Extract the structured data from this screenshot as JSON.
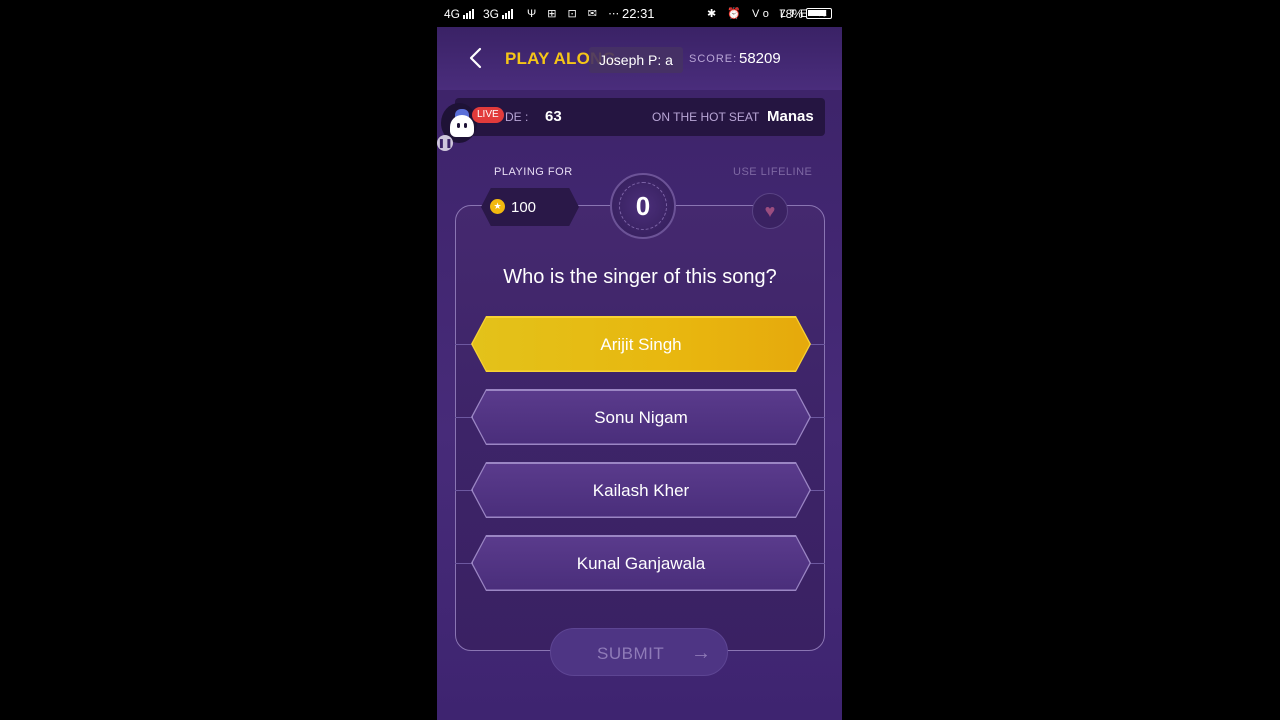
{
  "status_bar": {
    "signal1": "4G",
    "signal2": "3G",
    "time": "22:31",
    "left_icons": "Ψ ⊞ ⊡ ✉ ⋯",
    "right_icons": "✱ ⏰ Vo LTE ≋",
    "battery": "78%"
  },
  "header": {
    "title": "PLAY ALONG",
    "score_label": "SCORE:",
    "score_value": "58209",
    "toast": "Joseph P: a"
  },
  "info_bar": {
    "episode_label": "DE :",
    "episode_value": "63",
    "hotseat_label": "ON THE HOT SEAT",
    "hotseat_value": "Manas",
    "live_badge": "LIVE"
  },
  "game": {
    "playing_for_label": "PLAYING FOR",
    "coins_value": "100",
    "timer_value": "0",
    "use_lifeline_label": "USE LIFELINE",
    "question": "Who is the singer of this song?",
    "options": [
      {
        "label": "Arijit Singh",
        "selected": true
      },
      {
        "label": "Sonu Nigam",
        "selected": false
      },
      {
        "label": "Kailash Kher",
        "selected": false
      },
      {
        "label": "Kunal Ganjawala",
        "selected": false
      }
    ],
    "submit_label": "SUBMIT"
  },
  "colors": {
    "accent_gold": "#f5c518",
    "background_purple": "#412670",
    "selected_option": "#e8b70f",
    "live_red": "#e23b3b"
  }
}
